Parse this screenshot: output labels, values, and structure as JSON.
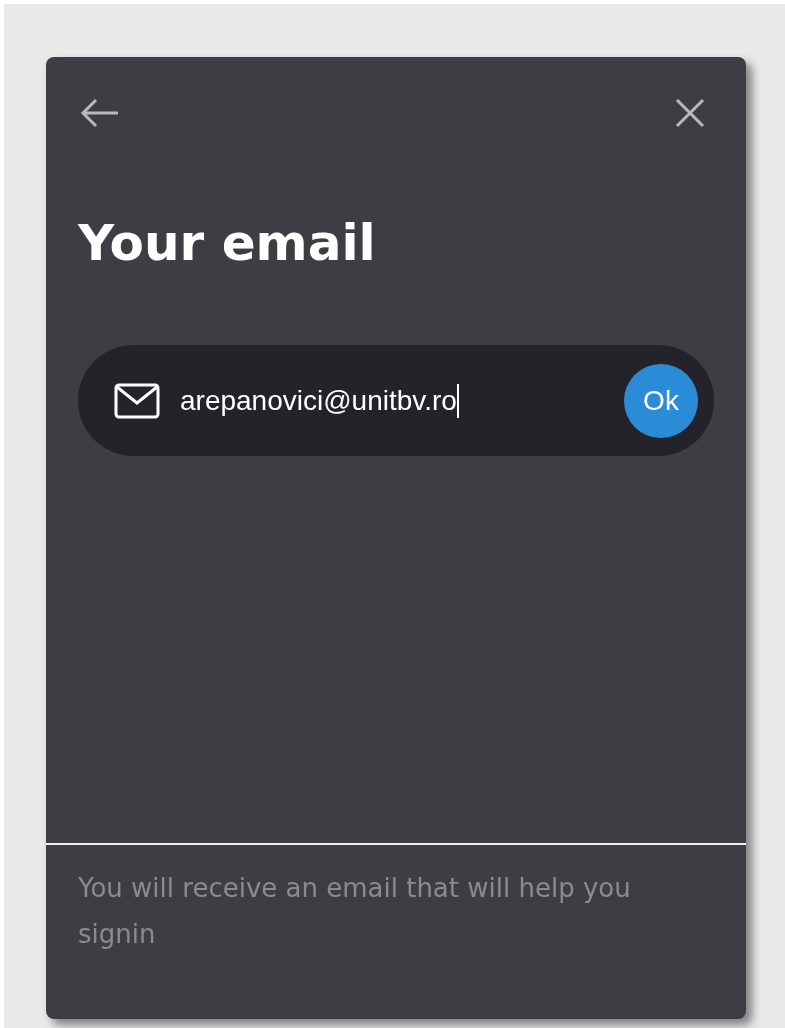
{
  "dialog": {
    "title": "Your email",
    "email_field": {
      "value": "arepanovici@unitbv.ro",
      "focused": true
    },
    "submit_button": {
      "label": "Ok"
    },
    "note": "You will receive an email that will help you signin"
  }
}
